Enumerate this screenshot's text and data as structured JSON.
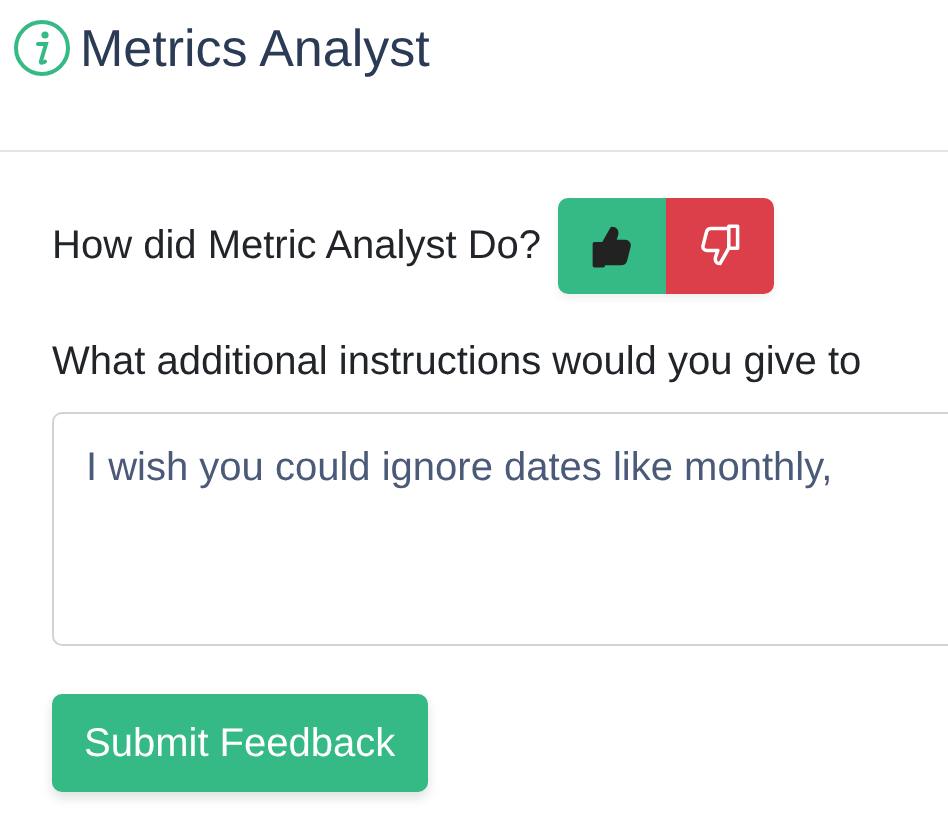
{
  "header": {
    "title": "Metrics Analyst"
  },
  "rating": {
    "question": "How did Metric Analyst Do?",
    "options": [
      {
        "kind": "up",
        "selected": true
      },
      {
        "kind": "down",
        "selected": false
      }
    ]
  },
  "instructions": {
    "label": "What additional instructions would you give to",
    "value": "I wish you could ignore dates like monthly,"
  },
  "submit": {
    "label": "Submit Feedback"
  }
}
